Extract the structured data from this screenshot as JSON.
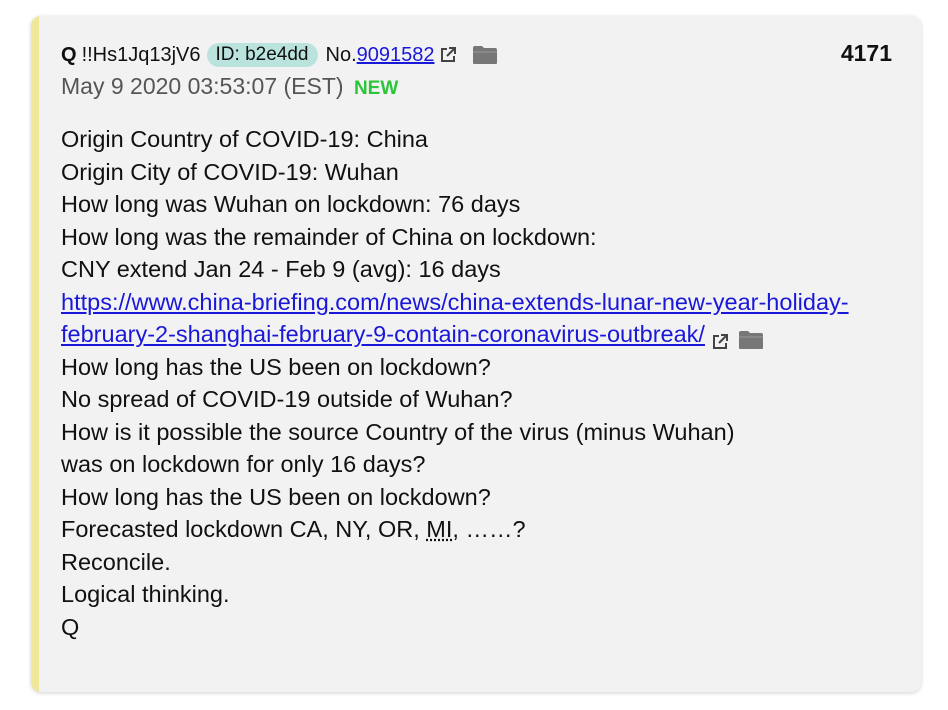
{
  "post": {
    "number": "4171",
    "author": "Q",
    "tripcode": "!!Hs1Jq13jV6",
    "id_label": "ID: b2e4dd",
    "no_prefix": "No.",
    "post_link": "9091582",
    "timestamp": "May 9 2020 03:53:07 (EST)",
    "new_label": "NEW"
  },
  "body": {
    "line1": "Origin Country of COVID-19: China",
    "line2": "Origin City of COVID-19: Wuhan",
    "line3": "How long was Wuhan on lockdown: 76 days",
    "line4": "How long was the remainder of China on lockdown:",
    "line5": "CNY extend Jan 24 - Feb 9 (avg): 16 days",
    "link": "https://www.china-briefing.com/news/china-extends-lunar-new-year-holiday-february-2-shanghai-february-9-contain-coronavirus-outbreak/",
    "line6": "How long has the US been on lockdown?",
    "line7": "No spread of COVID-19 outside of Wuhan?",
    "line8": "How is it possible the source Country of the virus (minus Wuhan)",
    "line9": "was on lockdown for only 16 days?",
    "line10": "How long has the US been on lockdown?",
    "line11_prefix": "Forecasted lockdown CA, NY, OR, ",
    "line11_abbr": "MI",
    "line11_suffix": ", ……?",
    "line12": "Reconcile.",
    "line13": "Logical thinking.",
    "signature": "Q"
  },
  "colors": {
    "accent_bar": "#efe79a",
    "id_badge": "#b9e3dc",
    "link": "#1a18d8",
    "new": "#2cc53a"
  },
  "icons": {
    "external": "external-link-icon",
    "folder": "folder-icon"
  }
}
